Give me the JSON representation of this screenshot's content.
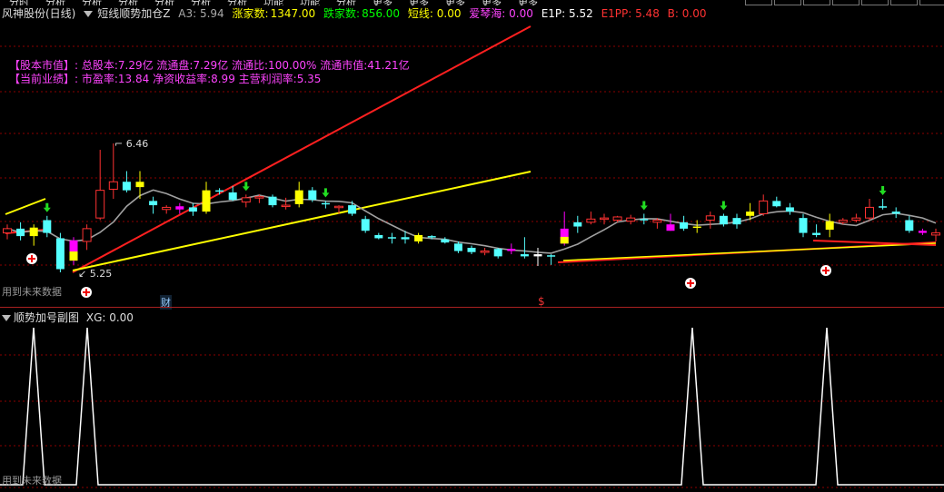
{
  "menu_items": [
    "分时",
    "分析",
    "分析",
    "分析",
    "分析",
    "分析",
    "分析",
    "功能",
    "功能",
    "分析",
    "更多",
    "更多",
    "更多",
    "更多",
    "更多"
  ],
  "header": {
    "stock_name": "风神股份(日线)",
    "indicator_name": "短线顺势加仓Z",
    "a3_label": "A3: 5.94",
    "up_count_label": "涨家数:",
    "up_count": "1347.00",
    "down_count_label": "跌家数:",
    "down_count": "856.00",
    "short_line": "短线: 0.00",
    "love_qin": "爱琴海: 0.00",
    "e1p": "E1P: 5.52",
    "e1pp": "E1PP: 5.48",
    "b": "B: 0.00"
  },
  "info": {
    "line1": "【股本市值】: 总股本:7.29亿 流通盘:7.29亿 流通比:100.00% 流通市值:41.21亿",
    "line2": "【当前业绩】: 市盈率:13.84 净资收益率:8.99 主营利润率:5.35"
  },
  "labels": {
    "high": "6.46",
    "low": "5.25",
    "future_data": "用到未来数据",
    "cai": "财",
    "dollar": "$"
  },
  "sub": {
    "title": "顺势加号副图",
    "xg": "XG: 0.00",
    "future_data": "用到未来数据"
  },
  "colors": {
    "up": "#ff3232",
    "down": "#54ffff",
    "yellow": "#ffff00",
    "magenta": "#ff00ff",
    "ma": "#a0a0a0",
    "grid": "#8b0000"
  },
  "chart_data": {
    "type": "candlestick",
    "price_labels": {
      "high": 6.46,
      "low": 5.25
    },
    "candles": [
      {
        "o": 5.62,
        "h": 5.7,
        "l": 5.56,
        "c": 5.66,
        "t": "up"
      },
      {
        "o": 5.66,
        "h": 5.72,
        "l": 5.55,
        "c": 5.59,
        "t": "down"
      },
      {
        "o": 5.59,
        "h": 5.7,
        "l": 5.5,
        "c": 5.67,
        "t": "yellow"
      },
      {
        "o": 5.74,
        "h": 5.78,
        "l": 5.58,
        "c": 5.62,
        "t": "down"
      },
      {
        "o": 5.57,
        "h": 5.62,
        "l": 5.25,
        "c": 5.28,
        "t": "down"
      },
      {
        "o": 5.36,
        "h": 5.58,
        "l": 5.32,
        "c": 5.55,
        "t": "magenta"
      },
      {
        "o": 5.54,
        "h": 5.7,
        "l": 5.46,
        "c": 5.66,
        "t": "up"
      },
      {
        "o": 5.76,
        "h": 6.4,
        "l": 5.74,
        "c": 6.02,
        "t": "up"
      },
      {
        "o": 6.03,
        "h": 6.46,
        "l": 5.94,
        "c": 6.1,
        "t": "up"
      },
      {
        "o": 6.1,
        "h": 6.2,
        "l": 6.0,
        "c": 6.02,
        "t": "down"
      },
      {
        "o": 6.1,
        "h": 6.2,
        "l": 5.94,
        "c": 6.05,
        "t": "yellow"
      },
      {
        "o": 5.88,
        "h": 5.96,
        "l": 5.8,
        "c": 5.92,
        "t": "down"
      },
      {
        "o": 5.84,
        "h": 5.88,
        "l": 5.8,
        "c": 5.86,
        "t": "up"
      },
      {
        "o": 5.87,
        "h": 5.9,
        "l": 5.8,
        "c": 5.84,
        "t": "magenta"
      },
      {
        "o": 5.86,
        "h": 5.9,
        "l": 5.78,
        "c": 5.82,
        "t": "down"
      },
      {
        "o": 5.82,
        "h": 6.1,
        "l": 5.8,
        "c": 6.02,
        "t": "yellow"
      },
      {
        "o": 6.02,
        "h": 6.04,
        "l": 5.98,
        "c": 6.01,
        "t": "down"
      },
      {
        "o": 6.0,
        "h": 6.06,
        "l": 5.92,
        "c": 5.93,
        "t": "down"
      },
      {
        "o": 5.91,
        "h": 5.98,
        "l": 5.86,
        "c": 5.95,
        "t": "up"
      },
      {
        "o": 5.95,
        "h": 5.98,
        "l": 5.9,
        "c": 5.96,
        "t": "up"
      },
      {
        "o": 5.96,
        "h": 5.98,
        "l": 5.86,
        "c": 5.88,
        "t": "down"
      },
      {
        "o": 5.88,
        "h": 5.95,
        "l": 5.84,
        "c": 5.87,
        "t": "up"
      },
      {
        "o": 5.89,
        "h": 6.1,
        "l": 5.86,
        "c": 6.02,
        "t": "yellow"
      },
      {
        "o": 6.02,
        "h": 6.05,
        "l": 5.91,
        "c": 5.93,
        "t": "down"
      },
      {
        "o": 5.9,
        "h": 5.92,
        "l": 5.85,
        "c": 5.89,
        "t": "down"
      },
      {
        "o": 5.86,
        "h": 5.88,
        "l": 5.8,
        "c": 5.87,
        "t": "up"
      },
      {
        "o": 5.88,
        "h": 5.92,
        "l": 5.78,
        "c": 5.8,
        "t": "down"
      },
      {
        "o": 5.75,
        "h": 5.78,
        "l": 5.62,
        "c": 5.64,
        "t": "down"
      },
      {
        "o": 5.6,
        "h": 5.62,
        "l": 5.56,
        "c": 5.57,
        "t": "down"
      },
      {
        "o": 5.58,
        "h": 5.62,
        "l": 5.52,
        "c": 5.58,
        "t": "down"
      },
      {
        "o": 5.58,
        "h": 5.64,
        "l": 5.52,
        "c": 5.56,
        "t": "down"
      },
      {
        "o": 5.6,
        "h": 5.62,
        "l": 5.52,
        "c": 5.54,
        "t": "yellow"
      },
      {
        "o": 5.58,
        "h": 5.6,
        "l": 5.56,
        "c": 5.59,
        "t": "down"
      },
      {
        "o": 5.56,
        "h": 5.58,
        "l": 5.52,
        "c": 5.53,
        "t": "down"
      },
      {
        "o": 5.52,
        "h": 5.54,
        "l": 5.43,
        "c": 5.45,
        "t": "down"
      },
      {
        "o": 5.44,
        "h": 5.5,
        "l": 5.42,
        "c": 5.48,
        "t": "down"
      },
      {
        "o": 5.44,
        "h": 5.48,
        "l": 5.41,
        "c": 5.45,
        "t": "up"
      },
      {
        "o": 5.4,
        "h": 5.48,
        "l": 5.38,
        "c": 5.47,
        "t": "down"
      },
      {
        "o": 5.47,
        "h": 5.52,
        "l": 5.42,
        "c": 5.45,
        "t": "magenta"
      },
      {
        "o": 5.42,
        "h": 5.58,
        "l": 5.38,
        "c": 5.4,
        "t": "down"
      },
      {
        "o": 5.4,
        "h": 5.48,
        "l": 5.31,
        "c": 5.42,
        "t": "white"
      },
      {
        "o": 5.4,
        "h": 5.42,
        "l": 5.32,
        "c": 5.41,
        "t": "down"
      },
      {
        "o": 5.52,
        "h": 5.82,
        "l": 5.5,
        "c": 5.66,
        "t": "magenta"
      },
      {
        "o": 5.72,
        "h": 5.78,
        "l": 5.62,
        "c": 5.68,
        "t": "down"
      },
      {
        "o": 5.72,
        "h": 5.82,
        "l": 5.7,
        "c": 5.75,
        "t": "up"
      },
      {
        "o": 5.76,
        "h": 5.8,
        "l": 5.7,
        "c": 5.75,
        "t": "up"
      },
      {
        "o": 5.74,
        "h": 5.78,
        "l": 5.72,
        "c": 5.77,
        "t": "up"
      },
      {
        "o": 5.73,
        "h": 5.79,
        "l": 5.7,
        "c": 5.76,
        "t": "up"
      },
      {
        "o": 5.75,
        "h": 5.8,
        "l": 5.7,
        "c": 5.74,
        "t": "down"
      },
      {
        "o": 5.72,
        "h": 5.76,
        "l": 5.66,
        "c": 5.74,
        "t": "up"
      },
      {
        "o": 5.7,
        "h": 5.8,
        "l": 5.64,
        "c": 5.64,
        "t": "magenta"
      },
      {
        "o": 5.72,
        "h": 5.78,
        "l": 5.64,
        "c": 5.66,
        "t": "down"
      },
      {
        "o": 5.68,
        "h": 5.74,
        "l": 5.62,
        "c": 5.68,
        "t": "yellow"
      },
      {
        "o": 5.74,
        "h": 5.82,
        "l": 5.66,
        "c": 5.78,
        "t": "up"
      },
      {
        "o": 5.7,
        "h": 5.8,
        "l": 5.68,
        "c": 5.78,
        "t": "down"
      },
      {
        "o": 5.76,
        "h": 5.8,
        "l": 5.66,
        "c": 5.7,
        "t": "down"
      },
      {
        "o": 5.78,
        "h": 5.9,
        "l": 5.74,
        "c": 5.82,
        "t": "yellow"
      },
      {
        "o": 5.8,
        "h": 5.98,
        "l": 5.78,
        "c": 5.92,
        "t": "up"
      },
      {
        "o": 5.92,
        "h": 5.96,
        "l": 5.86,
        "c": 5.87,
        "t": "down"
      },
      {
        "o": 5.86,
        "h": 5.9,
        "l": 5.79,
        "c": 5.82,
        "t": "down"
      },
      {
        "o": 5.76,
        "h": 5.8,
        "l": 5.58,
        "c": 5.62,
        "t": "down"
      },
      {
        "o": 5.62,
        "h": 5.7,
        "l": 5.58,
        "c": 5.6,
        "t": "down"
      },
      {
        "o": 5.65,
        "h": 5.8,
        "l": 5.58,
        "c": 5.73,
        "t": "yellow"
      },
      {
        "o": 5.72,
        "h": 5.76,
        "l": 5.7,
        "c": 5.74,
        "t": "up"
      },
      {
        "o": 5.74,
        "h": 5.8,
        "l": 5.72,
        "c": 5.76,
        "t": "up"
      },
      {
        "o": 5.76,
        "h": 5.94,
        "l": 5.74,
        "c": 5.86,
        "t": "up"
      },
      {
        "o": 5.87,
        "h": 5.94,
        "l": 5.84,
        "c": 5.86,
        "t": "down"
      },
      {
        "o": 5.82,
        "h": 5.86,
        "l": 5.76,
        "c": 5.8,
        "t": "down"
      },
      {
        "o": 5.74,
        "h": 5.78,
        "l": 5.62,
        "c": 5.64,
        "t": "down"
      },
      {
        "o": 5.62,
        "h": 5.66,
        "l": 5.6,
        "c": 5.64,
        "t": "magenta"
      },
      {
        "o": 5.6,
        "h": 5.66,
        "l": 5.54,
        "c": 5.62,
        "t": "up"
      }
    ]
  },
  "sub_chart": {
    "type": "line",
    "signals_at_candle_index": [
      1,
      4,
      47,
      66
    ]
  }
}
